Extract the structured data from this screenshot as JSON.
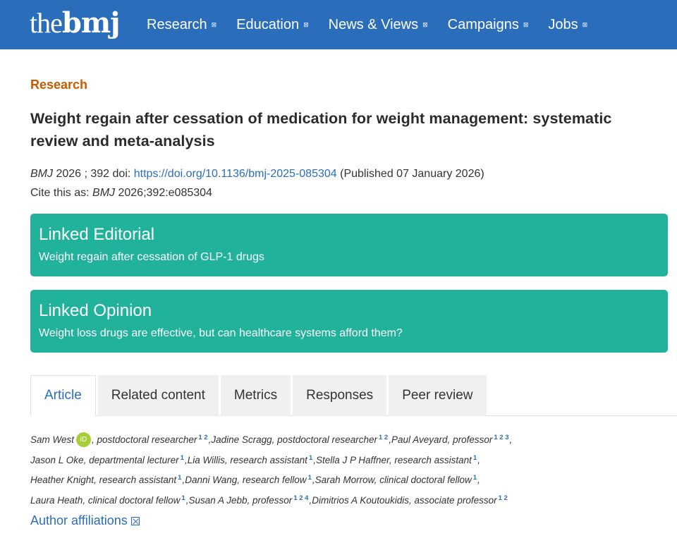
{
  "header": {
    "logo_the": "the",
    "logo_bmj": "bmj",
    "nav": [
      {
        "label": "Research",
        "icon": "chevron-icon"
      },
      {
        "label": "Education",
        "icon": "chevron-icon"
      },
      {
        "label": "News & Views",
        "icon": "chevron-icon"
      },
      {
        "label": "Campaigns",
        "icon": "chevron-icon"
      },
      {
        "label": "Jobs",
        "icon": "chevron-icon"
      }
    ],
    "chevron": "⊠"
  },
  "article": {
    "section": "Research",
    "title": "Weight regain after cessation of medication for weight management: systematic review and meta-analysis",
    "journal": "BMJ",
    "citation_text": " 2026 ; 392  doi: ",
    "doi_link": "https://doi.org/10.1136/bmj-2025-085304",
    "published": " (Published 07 January 2026)",
    "cite_prefix": "Cite this as: ",
    "cite_journal": "BMJ",
    "cite_ref": " 2026;392:e085304"
  },
  "linked": [
    {
      "heading": "Linked Editorial",
      "text": "Weight regain after cessation of GLP-1 drugs"
    },
    {
      "heading": "Linked Opinion",
      "text": "Weight loss drugs are effective, but can healthcare systems afford them?"
    }
  ],
  "tabs": [
    {
      "label": "Article",
      "active": true
    },
    {
      "label": "Related content",
      "active": false
    },
    {
      "label": "Metrics",
      "active": false
    },
    {
      "label": "Responses",
      "active": false
    },
    {
      "label": "Peer review",
      "active": false
    }
  ],
  "authors": [
    {
      "name": "Sam West",
      "orcid": true,
      "role": "postdoctoral researcher",
      "aff": "1 2"
    },
    {
      "name": "Jadine Scragg",
      "role": "postdoctoral researcher",
      "aff": "1 2"
    },
    {
      "name": "Paul Aveyard",
      "role": "professor",
      "aff": "1 2 3"
    },
    {
      "name": "Jason L Oke",
      "role": "departmental lecturer",
      "aff": "1"
    },
    {
      "name": "Lia Willis",
      "role": "research assistant",
      "aff": "1"
    },
    {
      "name": "Stella J P Haffner",
      "role": "research assistant",
      "aff": "1"
    },
    {
      "name": "Heather Knight",
      "role": "research assistant",
      "aff": "1"
    },
    {
      "name": "Danni Wang",
      "role": "research fellow",
      "aff": "1"
    },
    {
      "name": "Sarah Morrow",
      "role": "clinical doctoral fellow",
      "aff": "1"
    },
    {
      "name": "Laura Heath",
      "role": "clinical doctoral fellow",
      "aff": "1"
    },
    {
      "name": "Susan A Jebb",
      "role": "professor",
      "aff": "1 2 4"
    },
    {
      "name": "Dimitrios A Koutoukidis",
      "role": "associate professor",
      "aff": "1 2"
    }
  ],
  "orcid_label": "iD",
  "affiliations_link": "Author affiliations",
  "colors": {
    "brand": "#2a6ebb",
    "section": "#c75b00",
    "linked_box": "#20b29b",
    "orcid": "#a6ce39"
  }
}
